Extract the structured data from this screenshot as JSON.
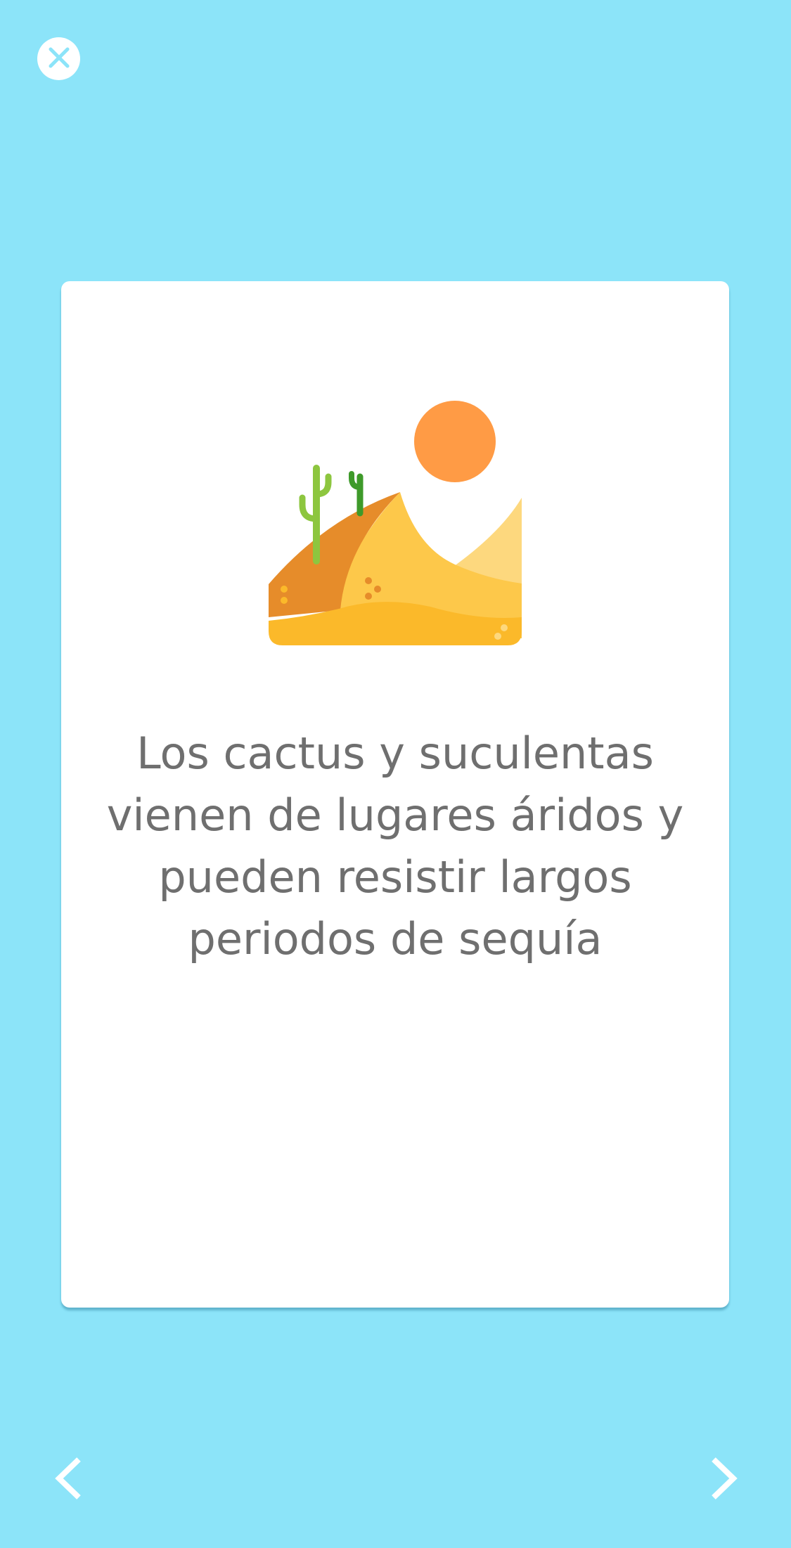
{
  "card": {
    "fact_text": "Los cactus y suculentas vienen de lugares áridos y pueden resistir largos periodos de sequía",
    "illustration_icon": "desert-with-cactus-and-sun-icon"
  },
  "controls": {
    "close_icon": "close-icon",
    "prev_icon": "chevron-left-icon",
    "next_icon": "chevron-right-icon"
  },
  "colors": {
    "background": "#8ce4f9",
    "card": "#ffffff",
    "text": "#6f6f6f",
    "sun": "#ff9b45",
    "dune_dark": "#e68c2a",
    "dune_mid": "#fdc84a",
    "dune_light": "#fdd87e",
    "sand": "#fbb92a",
    "cactus_light": "#8dc63f",
    "cactus_dark": "#3e9a2a"
  }
}
